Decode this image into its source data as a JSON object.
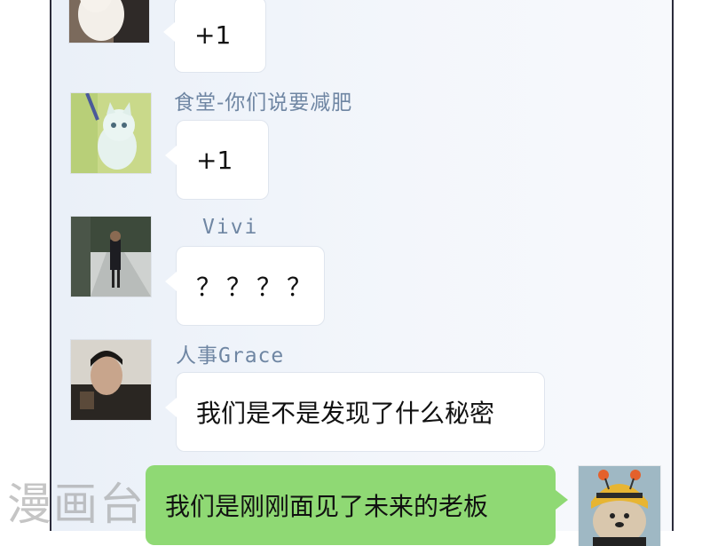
{
  "chat": {
    "messages": [
      {
        "sender": "",
        "text": "+1"
      },
      {
        "sender": "食堂-你们说要减肥",
        "text": "+1"
      },
      {
        "sender": "Vivi",
        "text": "？？？？"
      },
      {
        "sender": "人事Grace",
        "text": "我们是不是发现了什么秘密"
      },
      {
        "sender": "",
        "text": "我们是刚刚面见了未来的老板",
        "outgoing": true
      }
    ]
  },
  "watermark": "漫画台",
  "colors": {
    "outgoing_bubble": "#8fd974",
    "incoming_bubble": "#ffffff",
    "sender_name": "#6f86a3"
  }
}
